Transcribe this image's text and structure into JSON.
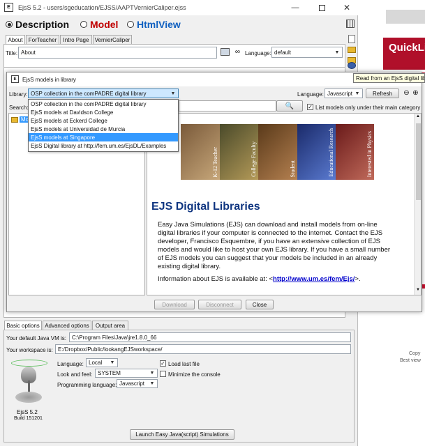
{
  "main_window": {
    "title": "EjsS 5.2 - users/sgeducation/EJSS/AAPTVernierCaliper.ejss",
    "modes": [
      {
        "label": "Description",
        "color": "#111111"
      },
      {
        "label": "Model",
        "color": "#c00000"
      },
      {
        "label": "HtmlView",
        "color": "#1060c0"
      }
    ],
    "tabs": [
      "About",
      "ForTeacher",
      "Intro Page",
      "VernierCaliper"
    ],
    "title_label": "Title:",
    "title_value": "About",
    "language_label": "Language:",
    "language_value": "default",
    "tooltip": "Read from an EjsS digital lib"
  },
  "library_dialog": {
    "title": "EjsS models in library",
    "library_label": "Library:",
    "library_selected": "OSP collection in the comPADRE digital library",
    "library_options": [
      "OSP collection in the comPADRE digital library",
      "EjsS models at Davidson College",
      "EjsS models at Eckerd College",
      "EjsS models at Universidad de Murcia",
      "EjsS models at Singapore",
      "EjsS Digital library at http://fem.um.es/EjsDL/Examples"
    ],
    "highlighted_index": 4,
    "language_label": "Language:",
    "language_value": "Javascript",
    "refresh_label": "Refresh",
    "search_label": "Search:",
    "tree_root": "Models",
    "list_models_label": "List models only under their main category",
    "banner_labels": [
      "K-12 Teacher",
      "College Faculty",
      "Student",
      "Educational Research",
      "Interested in Physics"
    ],
    "heading": "EJS Digital Libraries",
    "paragraph1": "Easy Java Simulations (EJS) can download and install models from on-line digital libraries if your computer is connected to the internet. Contact the EJS developer, Francisco Esquembre, if you have an extensive collection of EJS models and would like to host your own EJS library. If you have a small number of EJS models you can suggest that your models be included in an already existing digital library.",
    "paragraph2_prefix": "Information about EJS is available at: <",
    "paragraph2_link": "http://www.um.es/fem/Ejs/",
    "paragraph2_suffix": ">.",
    "buttons": {
      "download": "Download",
      "disconnect": "Disconnect",
      "close": "Close"
    }
  },
  "console_window": {
    "tabs": [
      "Basic options",
      "Advanced options",
      "Output area"
    ],
    "java_vm_label": "Your default Java VM is:",
    "java_vm_value": "C:\\Program Files\\Java\\jre1.8.0_66",
    "workspace_label": "Your workspace is:",
    "workspace_value": "E:/Dropbox/Public/lookangEJSworkspace/",
    "language_label": "Language:",
    "language_value": "Local",
    "look_label": "Look and feel:",
    "look_value": "SYSTEM",
    "prog_lang_label": "Programming language:",
    "prog_lang_value": "Javascript",
    "load_last_label": "Load last file",
    "minimize_label": "Minimize the console",
    "logo_name": "EjsS 5.2",
    "logo_build": "Build 151201",
    "launch_label": "Launch Easy Java(script) Simulations"
  },
  "background": {
    "quicklink_text": "QuickLi",
    "copy_text": "Copy",
    "bestview_text": "Best view"
  }
}
